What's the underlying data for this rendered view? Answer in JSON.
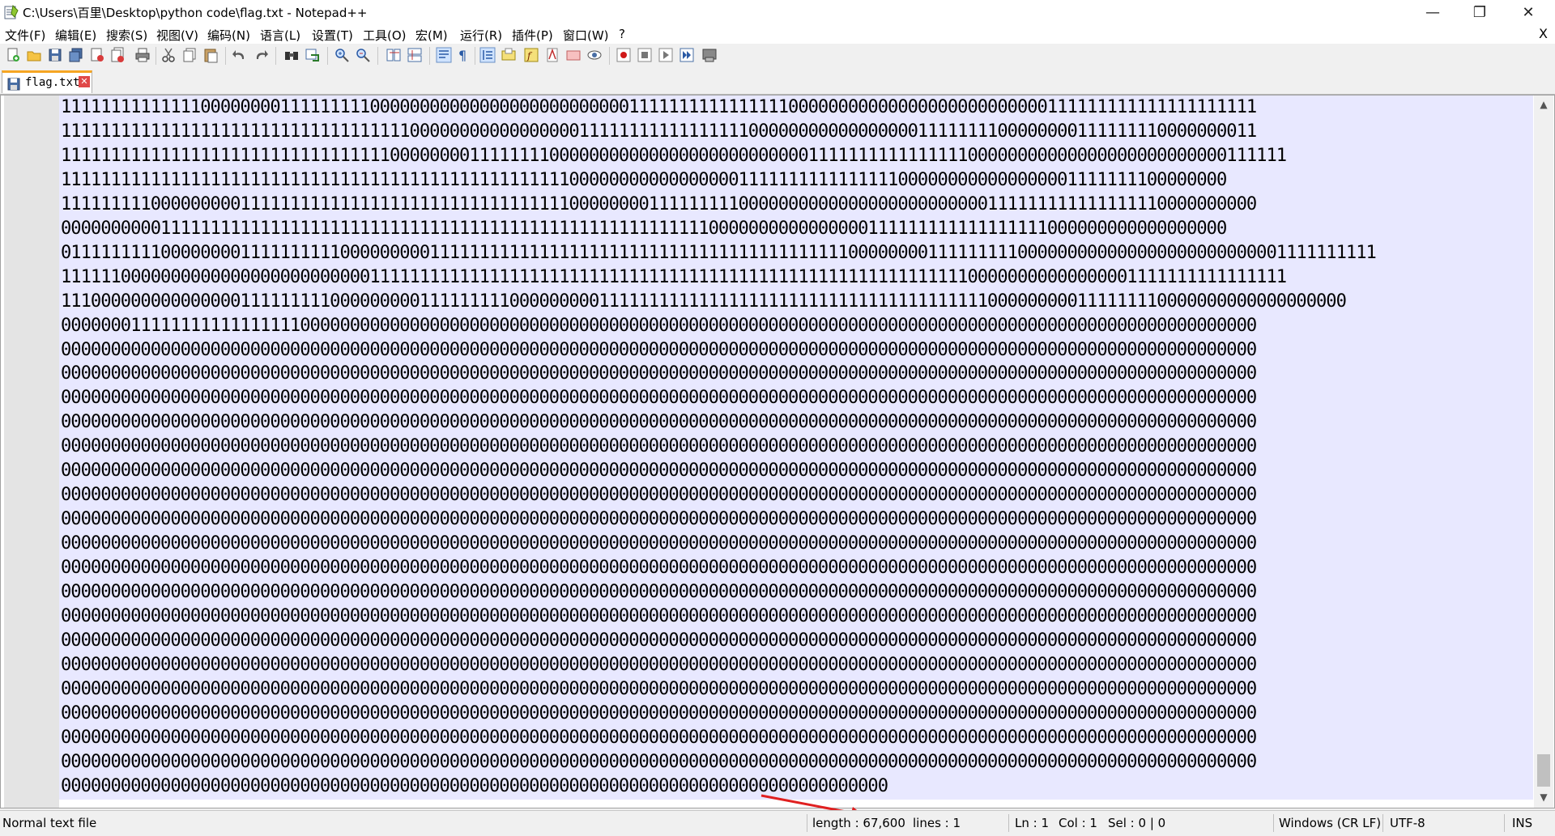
{
  "window": {
    "title": "C:\\Users\\百里\\Desktop\\python code\\flag.txt - Notepad++",
    "minimize": "—",
    "maximize": "❐",
    "close": "✕"
  },
  "menu": {
    "items": [
      "文件(F)",
      "编辑(E)",
      "搜索(S)",
      "视图(V)",
      "编码(N)",
      "语言(L)",
      "设置(T)",
      "工具(O)",
      "宏(M)",
      "运行(R)",
      "插件(P)",
      "窗口(W)",
      "?"
    ],
    "close_document": "X"
  },
  "toolbar": {
    "icons": [
      "new-file-icon",
      "open-file-icon",
      "save-icon",
      "save-all-icon",
      "close-icon",
      "close-all-icon",
      "print-icon",
      "cut-icon",
      "copy-icon",
      "paste-icon",
      "undo-icon",
      "redo-icon",
      "find-icon",
      "replace-icon",
      "zoom-in-icon",
      "zoom-out-icon",
      "sync-vertical-icon",
      "sync-horizontal-icon",
      "word-wrap-icon",
      "show-all-characters-icon",
      "indent-guide-icon",
      "document-map-icon",
      "function-list-icon",
      "folder-as-workspace-icon",
      "document-list-icon",
      "monitoring-icon",
      "record-macro-icon",
      "stop-macro-icon",
      "play-macro-icon",
      "run-macro-multiple-icon",
      "save-macro-icon"
    ]
  },
  "tabs": [
    {
      "label": "flag.txt",
      "close": "✕"
    }
  ],
  "editor": {
    "lines": [
      "111111111111110000000011111111100000000000000000000000000111111111111111100000000000000000000000000111111111111111111111",
      "111111111111111111111111111111111110000000000000000011111111111111111000000000000000001111111100000000111111110000000011",
      "111111111111111111111111111111111000000001111111100000000000000000000000000111111111111111100000000000000000000000000111111",
      "111111111111111111111111111111111111111111111111111000000000000000001111111111111111000000000000000001111111100000000",
      "111111111000000000111111111111111111111111111111111000000001111111110000000000000000000000000111111111111111110000000000",
      "000000000011111111111111111111111111111111111111111111111111111110000000000000000111111111111111111000000000000000000",
      "011111111100000000111111111100000000011111111111111111111111111111111111111111100000000111111111000000000000000000000000001111111111",
      "111111000000000000000000000000011111111111111111111111111111111111111111111111111111111111100000000000000001111111111111111",
      "111000000000000000111111111000000000111111111000000000111111111111111111111111111111111111111000000000111111110000000000000000000",
      "000000011111111111111111000000000000000000000000000000000000000000000000000000000000000000000000000000000000000000000000",
      "000000000000000000000000000000000000000000000000000000000000000000000000000000000000000000000000000000000000000000000000",
      "000000000000000000000000000000000000000000000000000000000000000000000000000000000000000000000000000000000000000000000000",
      "000000000000000000000000000000000000000000000000000000000000000000000000000000000000000000000000000000000000000000000000",
      "000000000000000000000000000000000000000000000000000000000000000000000000000000000000000000000000000000000000000000000000",
      "000000000000000000000000000000000000000000000000000000000000000000000000000000000000000000000000000000000000000000000000",
      "000000000000000000000000000000000000000000000000000000000000000000000000000000000000000000000000000000000000000000000000",
      "000000000000000000000000000000000000000000000000000000000000000000000000000000000000000000000000000000000000000000000000",
      "000000000000000000000000000000000000000000000000000000000000000000000000000000000000000000000000000000000000000000000000",
      "000000000000000000000000000000000000000000000000000000000000000000000000000000000000000000000000000000000000000000000000",
      "000000000000000000000000000000000000000000000000000000000000000000000000000000000000000000000000000000000000000000000000",
      "000000000000000000000000000000000000000000000000000000000000000000000000000000000000000000000000000000000000000000000000",
      "000000000000000000000000000000000000000000000000000000000000000000000000000000000000000000000000000000000000000000000000",
      "000000000000000000000000000000000000000000000000000000000000000000000000000000000000000000000000000000000000000000000000",
      "000000000000000000000000000000000000000000000000000000000000000000000000000000000000000000000000000000000000000000000000",
      "000000000000000000000000000000000000000000000000000000000000000000000000000000000000000000000000000000000000000000000000",
      "000000000000000000000000000000000000000000000000000000000000000000000000000000000000000000000000000000000000000000000000",
      "000000000000000000000000000000000000000000000000000000000000000000000000000000000000000000000000000000000000000000000000",
      "000000000000000000000000000000000000000000000000000000000000000000000000000000000000000000000000000000000000000000000000",
      "00000000000000000000000000000000000000000000000000000000000000000000000000000000000"
    ]
  },
  "status": {
    "file_type": "Normal text file",
    "length": "length : 67,600",
    "lines": "lines : 1",
    "ln": "Ln : 1",
    "col": "Col : 1",
    "sel": "Sel : 0 | 0",
    "eol": "Windows (CR LF)",
    "encoding": "UTF-8",
    "mode": "INS"
  },
  "colors": {
    "editor_background": "#e8e8ff",
    "tab_accent": "#f6a623",
    "annotation_arrow": "#e02020"
  }
}
